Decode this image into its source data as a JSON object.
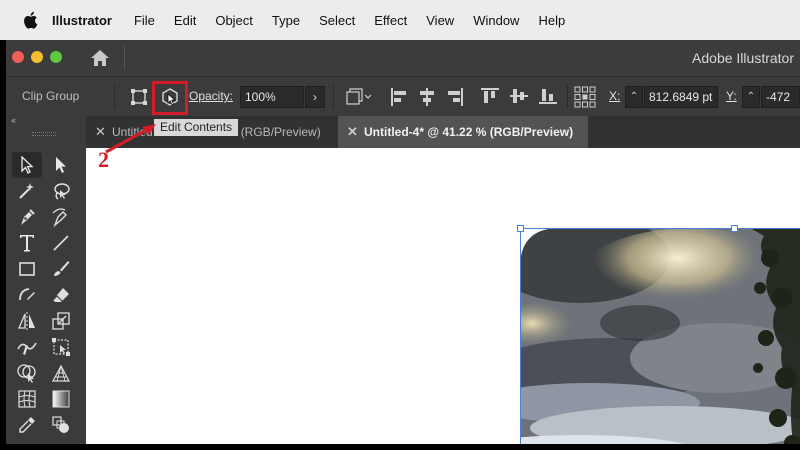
{
  "menubar": {
    "icon": "apple-icon",
    "items": [
      "Illustrator",
      "File",
      "Edit",
      "Object",
      "Type",
      "Select",
      "Effect",
      "View",
      "Window",
      "Help"
    ]
  },
  "window": {
    "title": "Adobe Illustrator"
  },
  "control_bar": {
    "selection_label": "Clip Group",
    "opacity_label": "Opacity:",
    "opacity_value": "100%",
    "x_label": "X:",
    "x_value": "812.6849 pt",
    "y_label": "Y:",
    "y_value": "-472"
  },
  "tooltip": {
    "text": "Edit Contents"
  },
  "annotation": {
    "step_number": "2",
    "color": "#d21c2a"
  },
  "tabs": [
    {
      "label": "Untitled-3* @ 41.22 % (RGB/Preview)",
      "visible_label": "Untitled",
      "visible_suffix": "(RGB/Preview)",
      "active": false
    },
    {
      "label": "Untitled-4* @ 41.22 % (RGB/Preview)",
      "active": true
    }
  ],
  "colors": {
    "accent_red": "#d21c2a",
    "selection_blue": "#4a7fd6",
    "panel_dark": "#3b3b3b"
  }
}
